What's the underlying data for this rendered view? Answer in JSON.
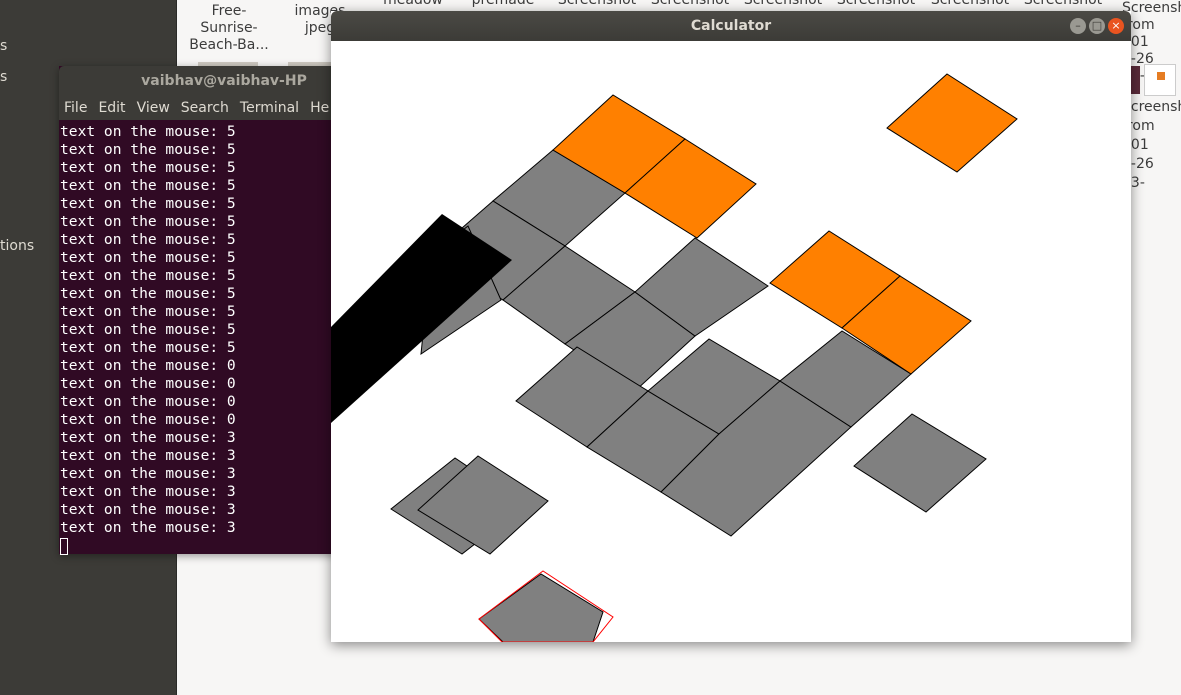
{
  "file_manager": {
    "sidebar_labels": [
      "s",
      "s",
      "tions"
    ],
    "files": [
      {
        "name": "Free-\nSunrise-\nBeach-Ba..."
      },
      {
        "name": "images\njpeg"
      },
      {
        "name": "meadow"
      },
      {
        "name": "premade"
      },
      {
        "name": "Screenshot"
      },
      {
        "name": "Screenshot"
      },
      {
        "name": "Screenshot"
      },
      {
        "name": "Screenshot"
      },
      {
        "name": "Screenshot"
      },
      {
        "name": "Screenshot"
      }
    ],
    "right_top_file": "Screensh\nfrom 201\n1-26 23-",
    "right_file": "Screensh\nfrom 201\n1-26 23-"
  },
  "terminal": {
    "title": "vaibhav@vaibhav-HP",
    "menu": [
      "File",
      "Edit",
      "View",
      "Search",
      "Terminal",
      "He"
    ],
    "lines": [
      "text on the mouse: 5",
      "text on the mouse: 5",
      "text on the mouse: 5",
      "text on the mouse: 5",
      "text on the mouse: 5",
      "text on the mouse: 5",
      "text on the mouse: 5",
      "text on the mouse: 5",
      "text on the mouse: 5",
      "text on the mouse: 5",
      "text on the mouse: 5",
      "text on the mouse: 5",
      "text on the mouse: 5",
      "text on the mouse: 0",
      "text on the mouse: 0",
      "text on the mouse: 0",
      "text on the mouse: 0",
      "text on the mouse: 3",
      "text on the mouse: 3",
      "text on the mouse: 3",
      "text on the mouse: 3",
      "text on the mouse: 3",
      "text on the mouse: 3"
    ],
    "background": "#300a24"
  },
  "calculator": {
    "title": "Calculator",
    "colors": {
      "gray": "#808080",
      "orange": "#ff8000",
      "black": "#000000",
      "highlight": "#ff0000"
    }
  }
}
